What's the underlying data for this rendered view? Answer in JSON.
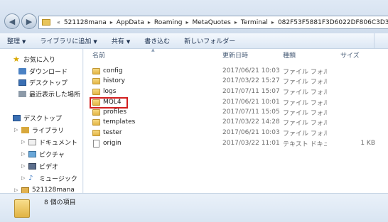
{
  "address": {
    "overflow_marker": "«",
    "crumbs": [
      "521128mana",
      "AppData",
      "Roaming",
      "MetaQuotes",
      "Terminal",
      "082F53F5881F3D6022DF806C3D307B50"
    ]
  },
  "toolbar": {
    "organize": "整理",
    "add_to_library": "ライブラリに追加",
    "share": "共有",
    "burn": "書き込む",
    "new_folder": "新しいフォルダー"
  },
  "nav": {
    "favorites": "お気に入り",
    "downloads": "ダウンロード",
    "desktop_fav": "デスクトップ",
    "recent": "最近表示した場所",
    "desktop": "デスクトップ",
    "libraries": "ライブラリ",
    "documents": "ドキュメント",
    "pictures": "ピクチャ",
    "videos": "ビデオ",
    "music": "ミュージック",
    "user": "521128mana"
  },
  "columns": {
    "name": "名前",
    "date": "更新日時",
    "type": "種類",
    "size": "サイズ"
  },
  "files": [
    {
      "name": "config",
      "date": "2017/06/21 10:03",
      "type": "ファイル フォル...",
      "size": "",
      "kind": "folder"
    },
    {
      "name": "history",
      "date": "2017/03/22 15:27",
      "type": "ファイル フォル...",
      "size": "",
      "kind": "folder"
    },
    {
      "name": "logs",
      "date": "2017/07/11 15:07",
      "type": "ファイル フォル...",
      "size": "",
      "kind": "folder"
    },
    {
      "name": "MQL4",
      "date": "2017/06/21 10:01",
      "type": "ファイル フォル...",
      "size": "",
      "kind": "folder"
    },
    {
      "name": "profiles",
      "date": "2017/07/11 15:05",
      "type": "ファイル フォル...",
      "size": "",
      "kind": "folder"
    },
    {
      "name": "templates",
      "date": "2017/03/22 14:28",
      "type": "ファイル フォル...",
      "size": "",
      "kind": "folder"
    },
    {
      "name": "tester",
      "date": "2017/06/21 10:03",
      "type": "ファイル フォル...",
      "size": "",
      "kind": "folder"
    },
    {
      "name": "origin",
      "date": "2017/03/22 11:01",
      "type": "テキスト ドキュ...",
      "size": "1 KB",
      "kind": "file"
    }
  ],
  "status": {
    "item_count": "8 個の項目"
  },
  "colors": {
    "highlight_box": "#d21f1f",
    "folder": "#e3b646"
  }
}
